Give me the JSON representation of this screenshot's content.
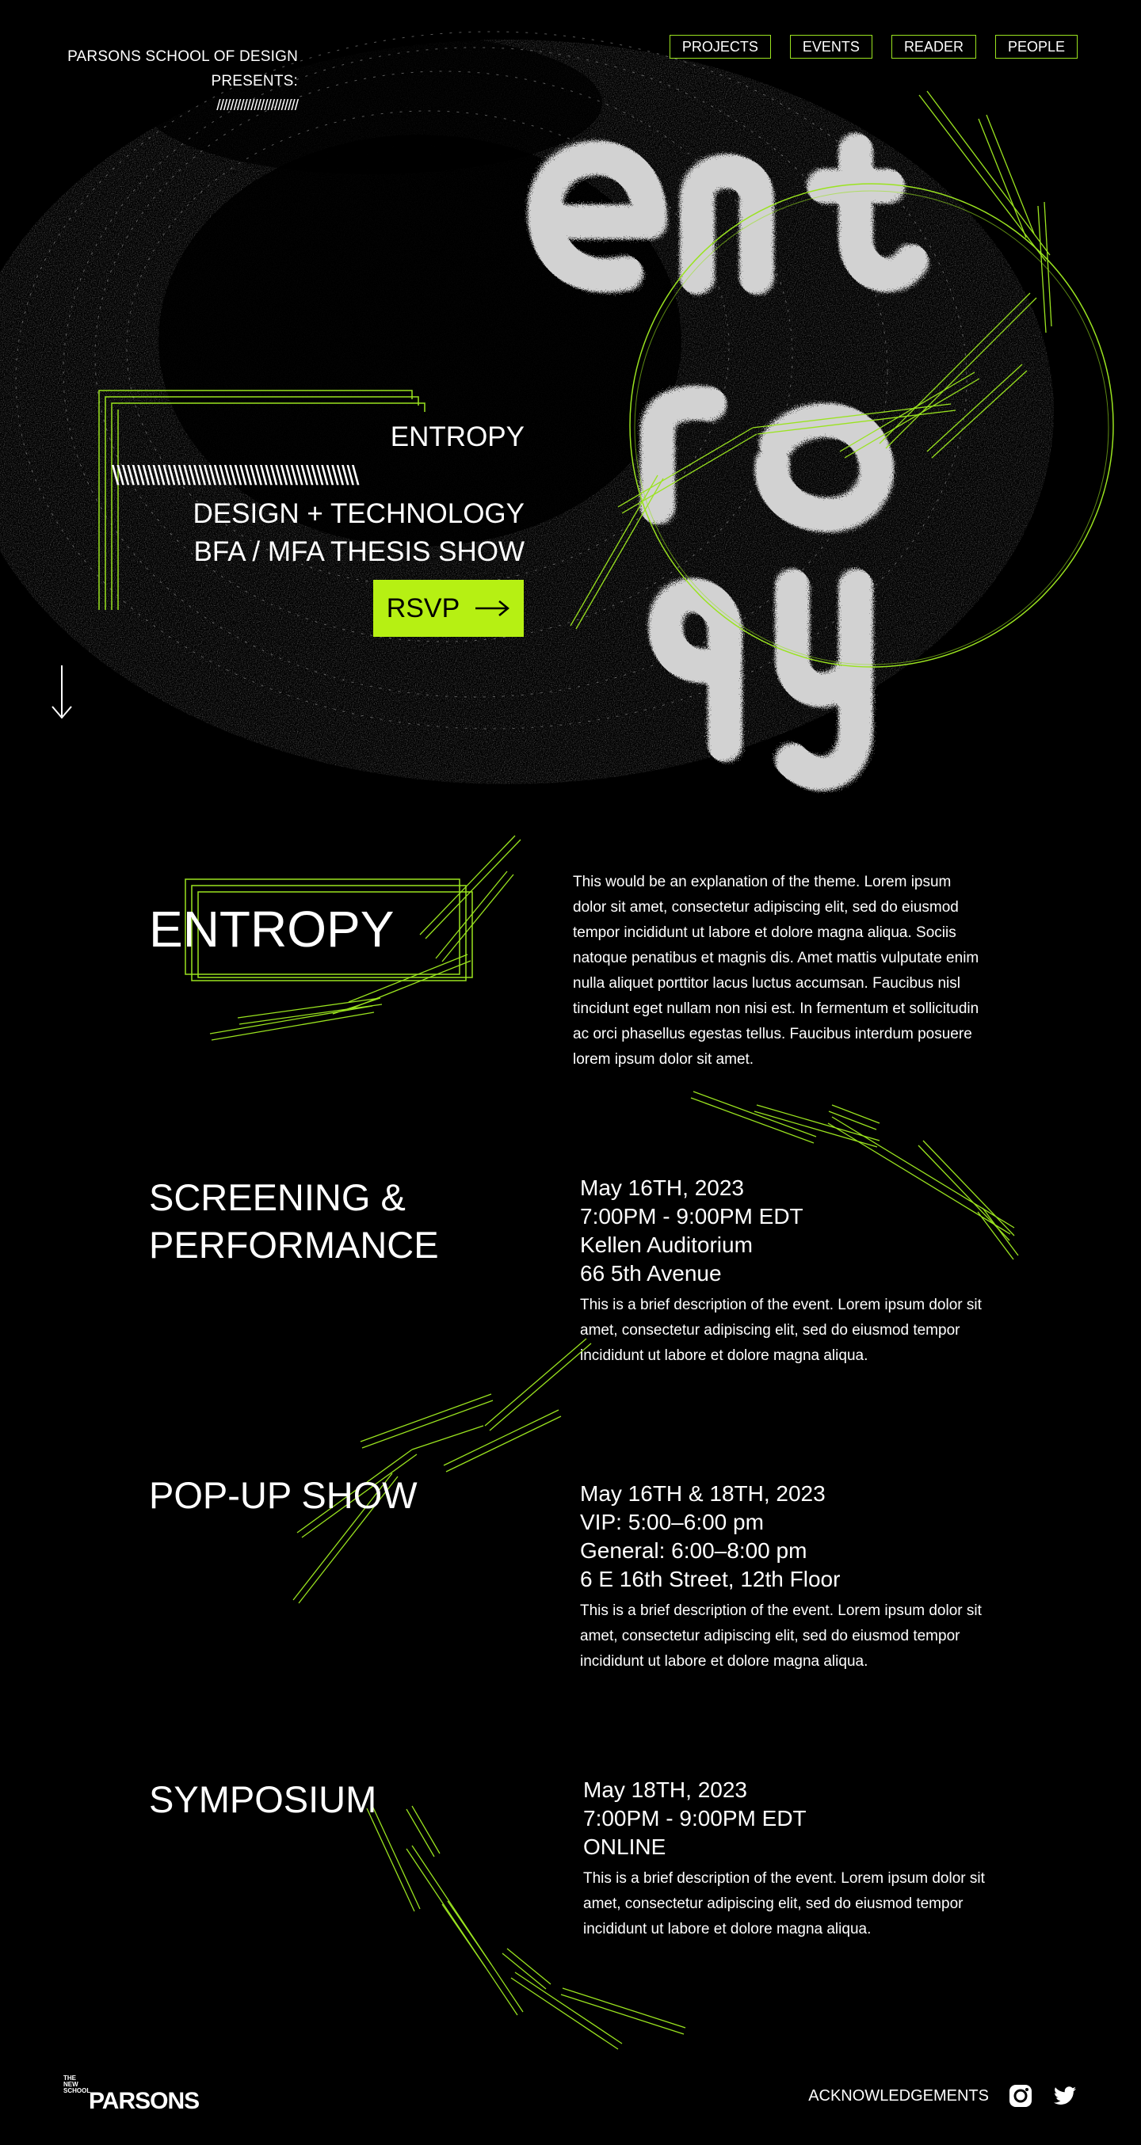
{
  "header": {
    "presents_line1": "PARSONS SCHOOL OF DESIGN",
    "presents_line2": "PRESENTS:",
    "presents_slashes": "////////////////////////"
  },
  "nav": {
    "items": [
      {
        "label": "PROJECTS"
      },
      {
        "label": "EVENTS"
      },
      {
        "label": "READER"
      },
      {
        "label": "PEOPLE"
      }
    ]
  },
  "hero": {
    "title": "ENTROPY",
    "slashes": "\\\\\\\\\\\\\\\\\\\\\\\\\\\\\\\\\\\\\\\\\\\\\\\\\\\\\\\\\\\\\\\\\\\\\\\\\\\\\\\\\\\\\\\\\\\\\\\\",
    "line1": "DESIGN + TECHNOLOGY",
    "line2": "BFA / MFA THESIS SHOW",
    "rsvp_label": "RSVP",
    "logo_word": "entropy"
  },
  "theme": {
    "title": "ENTROPY",
    "body": "This would be an explanation of the theme. Lorem ipsum dolor sit amet, consectetur adipiscing elit, sed do eiusmod tempor incididunt ut labore et dolore magna aliqua. Sociis natoque penatibus et magnis dis. Amet mattis vulputate enim nulla aliquet porttitor lacus luctus accumsan. Faucibus nisl tincidunt eget nullam non nisi est. In fermentum et sollicitudin ac orci phasellus egestas tellus. Faucibus interdum posuere lorem ipsum dolor sit amet."
  },
  "events": [
    {
      "title_line1": "SCREENING &",
      "title_line2": "PERFORMANCE",
      "meta": [
        "May 16TH, 2023",
        "7:00PM - 9:00PM EDT",
        "Kellen Auditorium",
        "66 5th Avenue"
      ],
      "desc": "This is a brief description of the event. Lorem ipsum dolor sit amet, consectetur adipiscing elit, sed do eiusmod tempor incididunt ut labore et dolore magna aliqua."
    },
    {
      "title_line1": "POP-UP SHOW",
      "title_line2": "",
      "meta": [
        "May 16TH & 18TH, 2023",
        "VIP: 5:00–6:00 pm",
        "General: 6:00–8:00 pm",
        "6 E 16th Street, 12th Floor"
      ],
      "desc": "This is a brief description of the event. Lorem ipsum dolor sit amet, consectetur adipiscing elit, sed do eiusmod tempor incididunt ut labore et dolore magna aliqua."
    },
    {
      "title_line1": "SYMPOSIUM",
      "title_line2": "",
      "meta": [
        "May 18TH, 2023",
        "7:00PM - 9:00PM EDT",
        "ONLINE"
      ],
      "desc": "This is a brief description of the event. Lorem ipsum dolor sit amet, consectetur adipiscing elit, sed do eiusmod tempor incididunt ut labore et dolore magna aliqua."
    }
  ],
  "footer": {
    "logo_small": [
      "THE",
      "NEW",
      "SCHOOL"
    ],
    "logo_word": "PARSONS",
    "ack_label": "ACKNOWLEDGEMENTS",
    "instagram_icon": "instagram-icon",
    "twitter_icon": "twitter-icon"
  },
  "colors": {
    "background": "#000000",
    "accent": "#b6f013",
    "line_accent": "#9ae31f",
    "text": "#ffffff",
    "noise": "#d8d8d8"
  }
}
